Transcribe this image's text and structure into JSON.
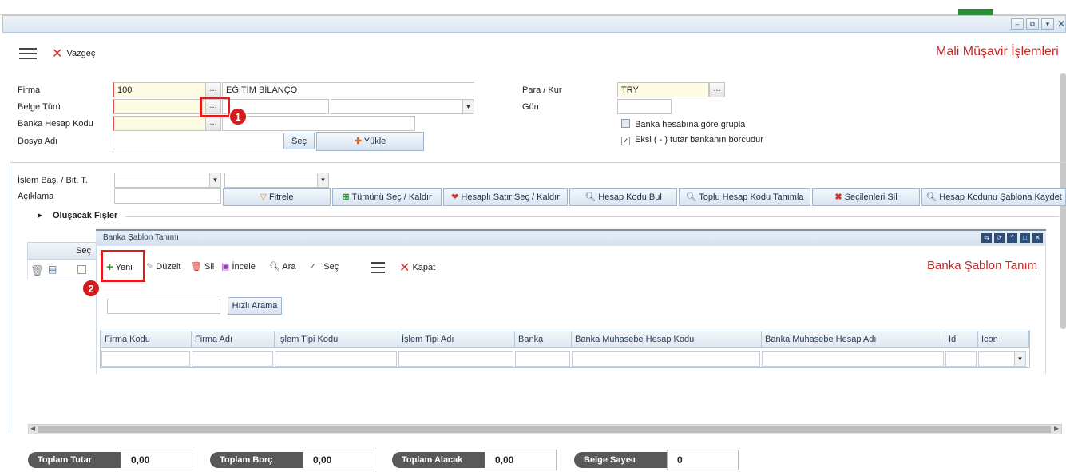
{
  "window": {
    "page_title": "Mali Müşavir İşlemleri",
    "cancel_label": "Vazgeç"
  },
  "form": {
    "firma_label": "Firma",
    "firma_code": "100",
    "firma_name": "EĞİTİM BİLANÇO",
    "belge_turu_label": "Belge Türü",
    "banka_hesap_kodu_label": "Banka Hesap Kodu",
    "dosya_adi_label": "Dosya Adı",
    "sec_label": "Seç",
    "yukle_label": "Yükle",
    "para_kur_label": "Para / Kur",
    "para_kur_value": "TRY",
    "gun_label": "Gün",
    "grupla_label": "Banka hesabına göre grupla",
    "eksi_label": "Eksi ( - ) tutar bankanın borcudur",
    "dots": "..."
  },
  "filter": {
    "islem_label": "İşlem Baş. / Bit. T.",
    "aciklama_label": "Açıklama",
    "buttons": [
      "Fitrele",
      "Tümünü Seç / Kaldır",
      "Hesaplı Satır Seç / Kaldır",
      "Hesap Kodu Bul",
      "Toplu Hesap Kodu Tanımla",
      "Seçilenleri Sil",
      "Hesap Kodunu Şablona Kaydet"
    ]
  },
  "section": {
    "title": "Oluşacak Fişler",
    "sec_col": "Seç"
  },
  "modal": {
    "title": "Banka Şablon Tanımı",
    "heading": "Banka Şablon Tanım",
    "toolbar": {
      "yeni": "Yeni",
      "duzelt": "Düzelt",
      "sil": "Sil",
      "incele": "İncele",
      "ara": "Ara",
      "sec": "Seç",
      "kapat": "Kapat"
    },
    "search_button": "Hızlı Arama",
    "columns": [
      "Firma Kodu",
      "Firma Adı",
      "İşlem Tipi Kodu",
      "İşlem Tipi Adı",
      "Banka",
      "Banka Muhasebe Hesap Kodu",
      "Banka Muhasebe Hesap Adı",
      "Id",
      "Icon"
    ]
  },
  "badges": {
    "one": "1",
    "two": "2"
  },
  "totals": [
    {
      "label": "Toplam Tutar",
      "value": "0,00"
    },
    {
      "label": "Toplam Borç",
      "value": "0,00"
    },
    {
      "label": "Toplam Alacak",
      "value": "0,00"
    },
    {
      "label": "Belge Sayısı",
      "value": "0"
    }
  ],
  "colors": {
    "accent_red": "#d32f2f",
    "highlight": "#e01b1b"
  }
}
